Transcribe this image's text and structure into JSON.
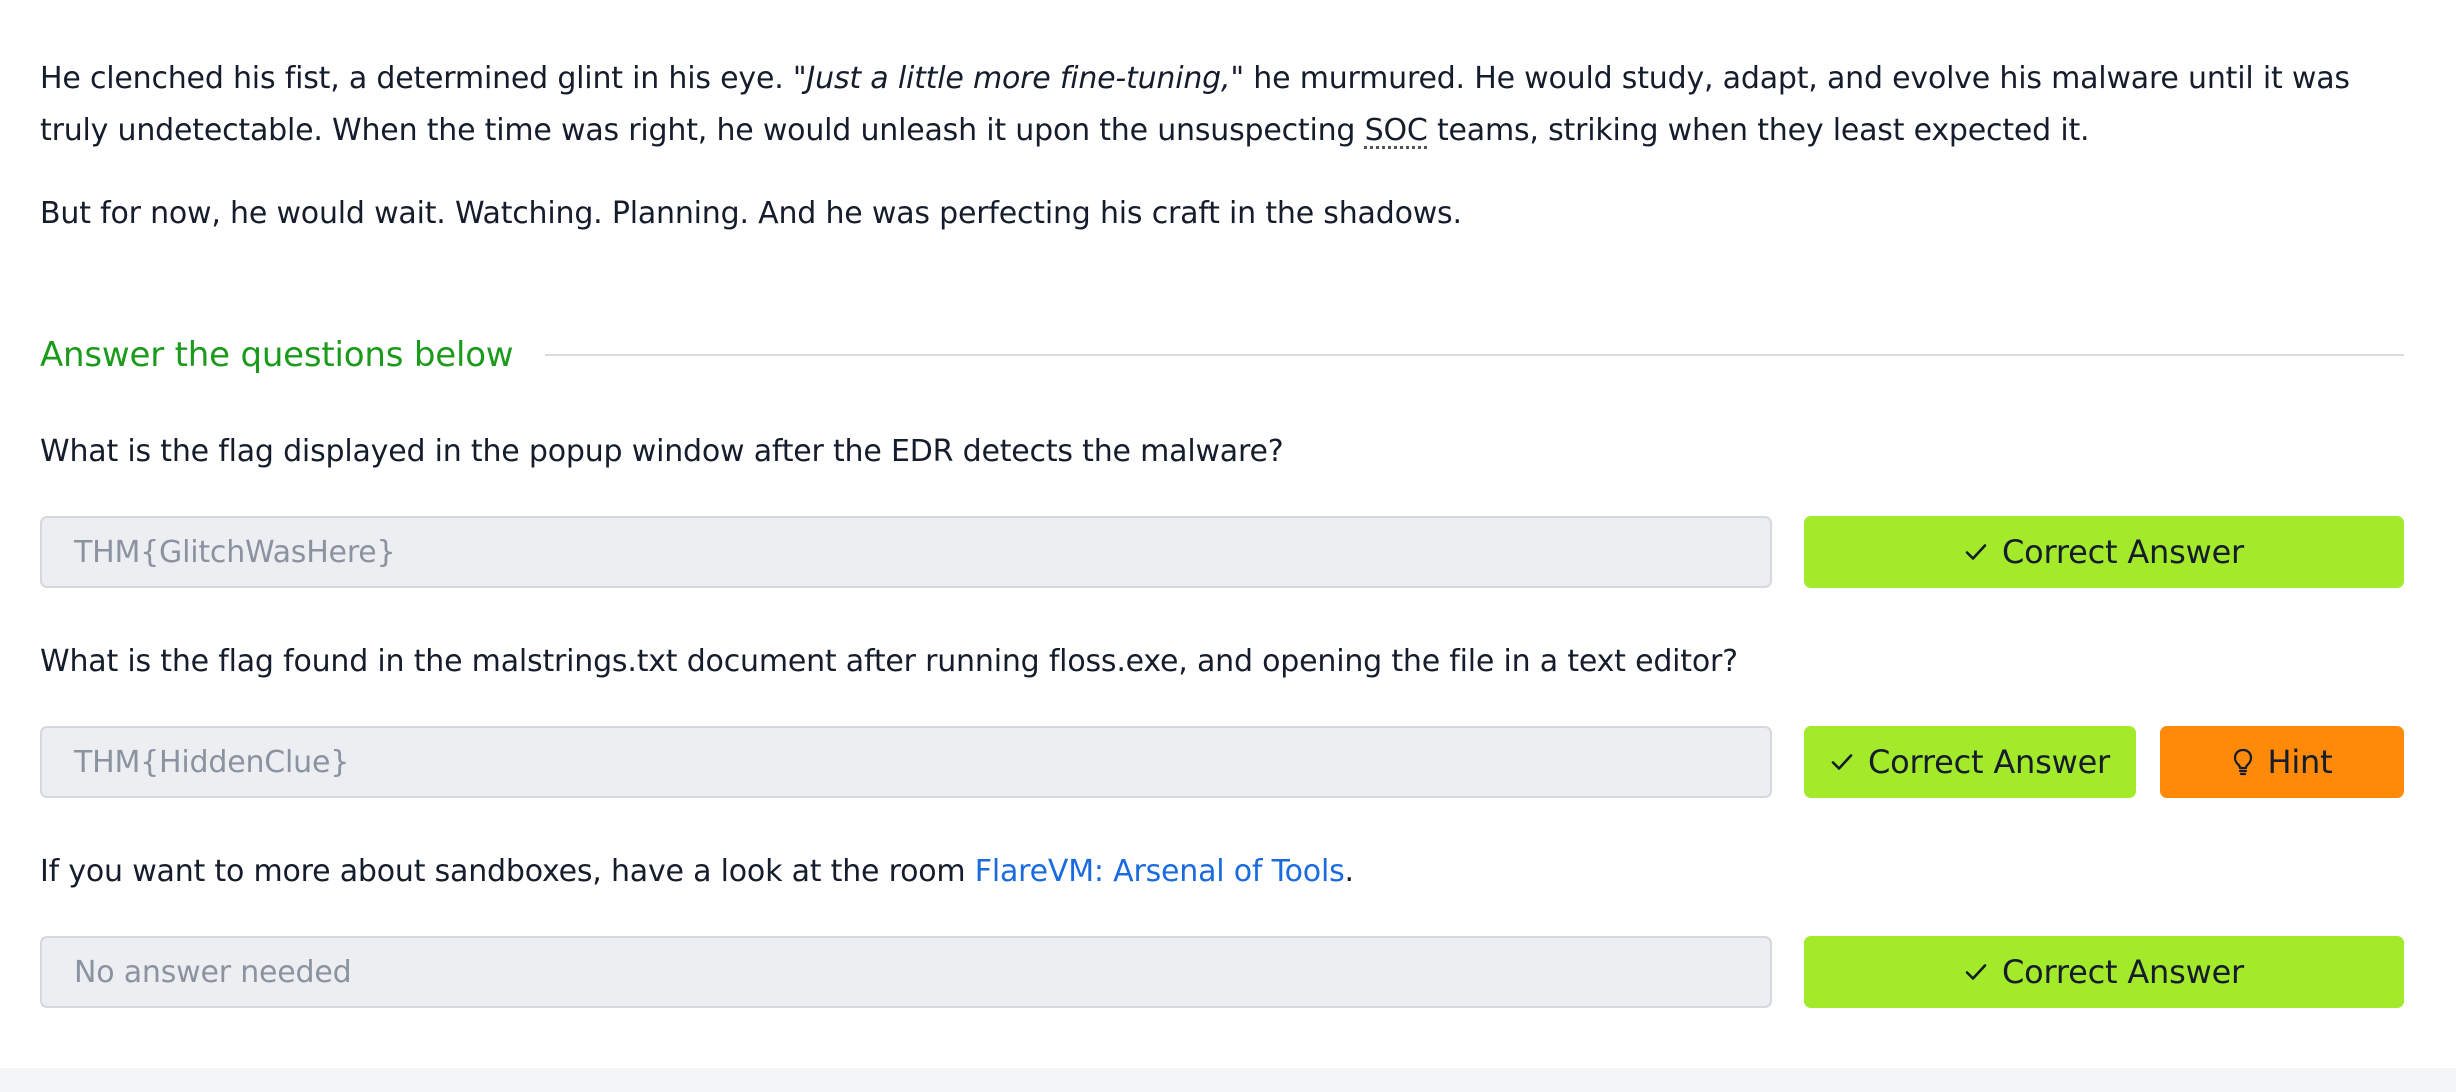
{
  "story": {
    "p1_a": "He clenched his fist, a determined glint in his eye. ",
    "p1_quote": "\"Just a little more fine-tuning,\"",
    "p1_b": " he murmured. He would study, adapt, and evolve his malware until it was truly undetectable. When the time was right, he would unleash it upon the unsuspecting ",
    "p1_abbr": "SOC",
    "p1_c": " teams, striking when they least expected it.",
    "p2": "But for now, he would wait. Watching. Planning. And he was perfecting his craft in the shadows."
  },
  "section": {
    "title": "Answer the questions below"
  },
  "questions": [
    {
      "text": "What is the flag displayed in the popup window after the EDR detects the malware?",
      "answer": "THM{GlitchWasHere}",
      "button": "Correct Answer"
    },
    {
      "text": "What is the flag found in the malstrings.txt document after running floss.exe, and opening the file in a text editor?",
      "answer": "THM{HiddenClue}",
      "button": "Correct Answer",
      "hint": "Hint"
    },
    {
      "text_a": "If you want to more about sandboxes, have a look at the room ",
      "link": "FlareVM: Arsenal of Tools",
      "text_b": ".",
      "answer": "No answer needed",
      "button": "Correct Answer"
    }
  ],
  "icons": {
    "check": "check-icon",
    "hint": "lightbulb-icon"
  },
  "colors": {
    "section_title": "#1c9a1c",
    "correct_button": "#a3ea2a",
    "hint_button": "#ff8a0a",
    "link": "#1a6be0"
  }
}
